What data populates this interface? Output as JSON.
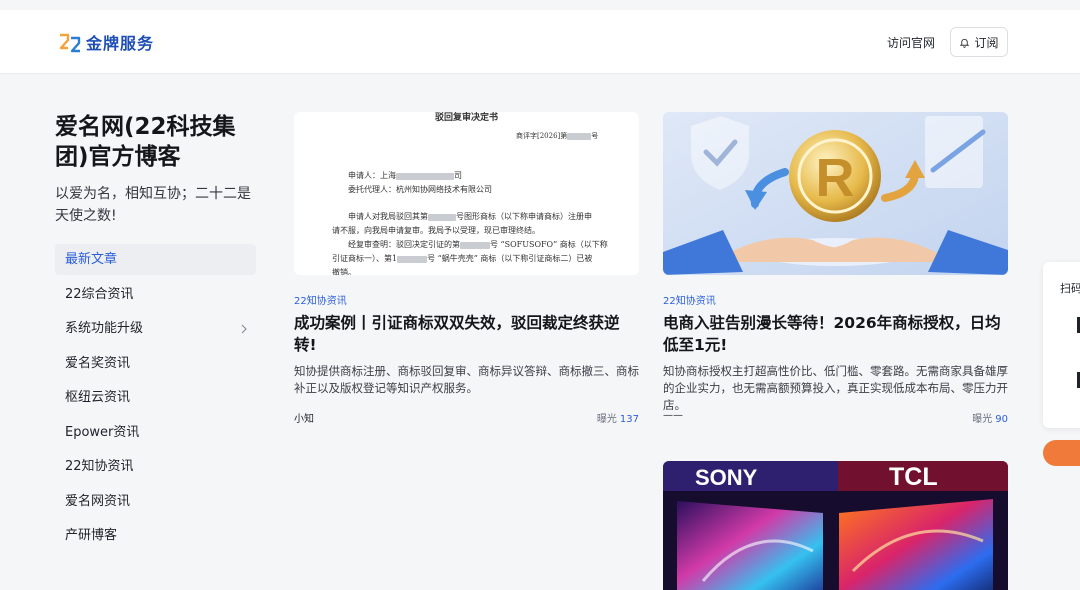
{
  "header": {
    "logo_text": "金牌服务",
    "nav_link": "访问官网",
    "subscribe_label": "订阅"
  },
  "sidebar": {
    "title": "爱名网(22科技集团)官方博客",
    "description": "以爱为名，相知互协；二十二是天使之数!",
    "items": [
      {
        "label": "最新文章"
      },
      {
        "label": "22综合资讯"
      },
      {
        "label": "系统功能升级"
      },
      {
        "label": "爱名奖资讯"
      },
      {
        "label": "枢纽云资讯"
      },
      {
        "label": "Epower资讯"
      },
      {
        "label": "22知协资讯"
      },
      {
        "label": "爱名网资讯"
      },
      {
        "label": "产研博客"
      }
    ]
  },
  "articles": [
    {
      "tag": "22知协资讯",
      "title": "成功案例丨引证商标双双失效，驳回裁定终获逆转!",
      "excerpt": "知协提供商标注册、商标驳回复审、商标异议答辩、商标撤三、商标补正以及版权登记等知识产权服务。",
      "author": "小知",
      "views_label": "曝光",
      "views": "137",
      "image_text": {
        "heading": "驳回复审决定书",
        "ref_a": "商评字[2026]第",
        "ref_b": "号",
        "applicant_a": "申请人：上海",
        "applicant_b": "司",
        "agent": "委托代理人：杭州知协网络技术有限公司",
        "p1_a": "申请人对我局驳回其第",
        "p1_b": "号图形商标（以下称申请商标）注册申",
        "p1_c": "请不服，向我局申请复审。我局予以受理，现已审理终结。",
        "p2_a": "经复审查明：驳回决定引证的第",
        "p2_b": "号 “SOFUSOFO” 商标（以下称",
        "p2_c": "引证商标一）、第1",
        "p2_d": "号 “蜗牛壳壳” 商标（以下称引证商标二）已被",
        "p2_e": "撤销。"
      }
    },
    {
      "tag": "22知协资讯",
      "title": "电商入驻告别漫长等待！2026年商标授权，日均低至1元!",
      "excerpt": "知协商标授权主打超高性价比、低门槛、零套路。无需商家具备雄厚的企业实力，也无需高额预算投入，真正实现低成本布局、零压力开店。",
      "author": "——",
      "views_label": "曝光",
      "views": "90",
      "image_text": {
        "letter": "R"
      }
    },
    {
      "image_text": {
        "brand_a": "SONY",
        "brand_b": "TCL"
      }
    }
  ],
  "side_widget": {
    "label": "扫码"
  },
  "colors": {
    "accent": "#2b5fd9",
    "logo": "#1f4fb5",
    "promo": "#f07a3a"
  }
}
